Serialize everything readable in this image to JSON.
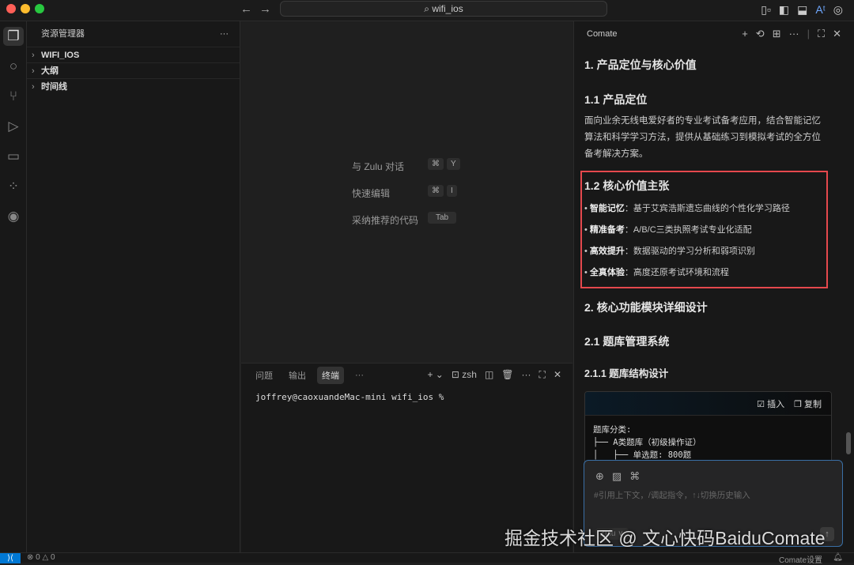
{
  "titlebar": {
    "search": "wifi_ios",
    "back": "←",
    "forward": "→"
  },
  "activity": [
    "files-icon",
    "search-icon",
    "source-control-icon",
    "run-debug-icon",
    "remote-explorer-icon",
    "extensions-icon",
    "browser-icon"
  ],
  "sidebar": {
    "title": "资源管理器",
    "more": "···",
    "items": [
      {
        "label": "WIFI_IOS"
      },
      {
        "label": "大纲"
      },
      {
        "label": "时间线"
      }
    ]
  },
  "editor": {
    "hints": [
      {
        "label": "与 Zulu 对话",
        "key1": "⌘",
        "key2": "Y"
      },
      {
        "label": "快速编辑",
        "key1": "⌘",
        "key2": "I"
      },
      {
        "label": "采纳推荐的代码",
        "key1": "Tab"
      }
    ]
  },
  "panel": {
    "tabs": [
      "问题",
      "输出",
      "终端"
    ],
    "active_tab": "终端",
    "more": "···",
    "shell": "zsh",
    "terminal_line": "joffrey@caoxuandeMac-mini wifi_ios %"
  },
  "chat": {
    "title": "Comate",
    "h1": "1. 产品定位与核心价值",
    "h1_1": "1.1 产品定位",
    "p1": "面向业余无线电爱好者的专业考试备考应用，结合智能记忆算法和科学学习方法，提供从基础练习到模拟考试的全方位备考解决方案。",
    "h1_2": "1.2 核心价值主张",
    "bullets": [
      {
        "b": "智能记忆",
        "t": "：基于艾宾浩斯遗忘曲线的个性化学习路径"
      },
      {
        "b": "精准备考",
        "t": "：A/B/C三类执照考试专业化适配"
      },
      {
        "b": "高效提升",
        "t": "：数据驱动的学习分析和弱项识别"
      },
      {
        "b": "全真体验",
        "t": "：高度还原考试环境和流程"
      }
    ],
    "h2": "2. 核心功能模块详细设计",
    "h2_1": "2.1 题库管理系统",
    "h2_1_1": "2.1.1 题库结构设计",
    "code": {
      "insert": "插入",
      "copy": "复制",
      "text": "题库分类:\n├── A类题库（初级操作证）\n│   ├── 单选题: 800题"
    },
    "input": {
      "placeholder": "#引用上下文，/调起指令，↑↓切换历史输入",
      "model": "Zulu ∨"
    },
    "highlight_color": "#e5484d"
  },
  "status": {
    "errors": "0",
    "warnings": "0",
    "comate_settings": "Comate设置"
  },
  "watermark": "掘金技术社区 @ 文心快码BaiduComate"
}
